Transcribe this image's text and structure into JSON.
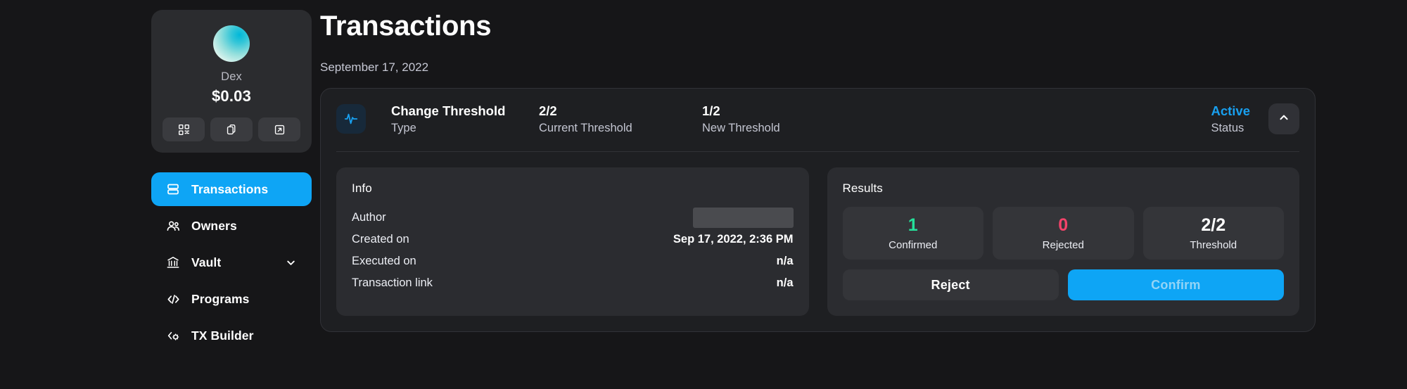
{
  "sidebar": {
    "wallet": {
      "avatar_icon": "wallet-avatar-gradient",
      "name": "Dex",
      "balance": "$0.03",
      "actions": [
        {
          "icon": "qr-code-icon",
          "name": "qr-code-button"
        },
        {
          "icon": "copy-icon",
          "name": "copy-address-button"
        },
        {
          "icon": "external-link-icon",
          "name": "open-external-button"
        }
      ]
    },
    "nav": [
      {
        "label": "Transactions",
        "icon": "transactions-icon",
        "active": true,
        "expandable": false
      },
      {
        "label": "Owners",
        "icon": "owners-icon",
        "active": false,
        "expandable": false
      },
      {
        "label": "Vault",
        "icon": "vault-icon",
        "active": false,
        "expandable": true
      },
      {
        "label": "Programs",
        "icon": "programs-code-icon",
        "active": false,
        "expandable": false
      },
      {
        "label": "TX Builder",
        "icon": "tx-builder-icon",
        "active": false,
        "expandable": false
      }
    ]
  },
  "main": {
    "title": "Transactions",
    "date_group": "September 17, 2022",
    "transaction": {
      "type_icon": "activity-pulse-icon",
      "type_value": "Change Threshold",
      "type_label": "Type",
      "current_threshold_value": "2/2",
      "current_threshold_label": "Current Threshold",
      "new_threshold_value": "1/2",
      "new_threshold_label": "New Threshold",
      "status_value": "Active",
      "status_label": "Status",
      "collapse_icon": "chevron-up-icon",
      "info": {
        "title": "Info",
        "rows": [
          {
            "key": "Author",
            "value": "",
            "redacted": true
          },
          {
            "key": "Created on",
            "value": "Sep 17, 2022, 2:36 PM",
            "redacted": false
          },
          {
            "key": "Executed on",
            "value": "n/a",
            "redacted": false
          },
          {
            "key": "Transaction link",
            "value": "n/a",
            "redacted": false
          }
        ]
      },
      "results": {
        "title": "Results",
        "tiles": [
          {
            "number": "1",
            "caption": "Confirmed",
            "color": "#25e09a"
          },
          {
            "number": "0",
            "caption": "Rejected",
            "color": "#f2436a"
          },
          {
            "number": "2/2",
            "caption": "Threshold",
            "color": "#ffffff"
          }
        ],
        "reject_label": "Reject",
        "confirm_label": "Confirm"
      }
    }
  },
  "colors": {
    "accent_blue": "#0ea5f5",
    "status_active": "#18a0f0",
    "confirmed_green": "#25e09a",
    "rejected_red": "#f2436a",
    "page_bg": "#161618",
    "card_bg": "#1e1f22",
    "panel_bg": "#2b2c30"
  }
}
